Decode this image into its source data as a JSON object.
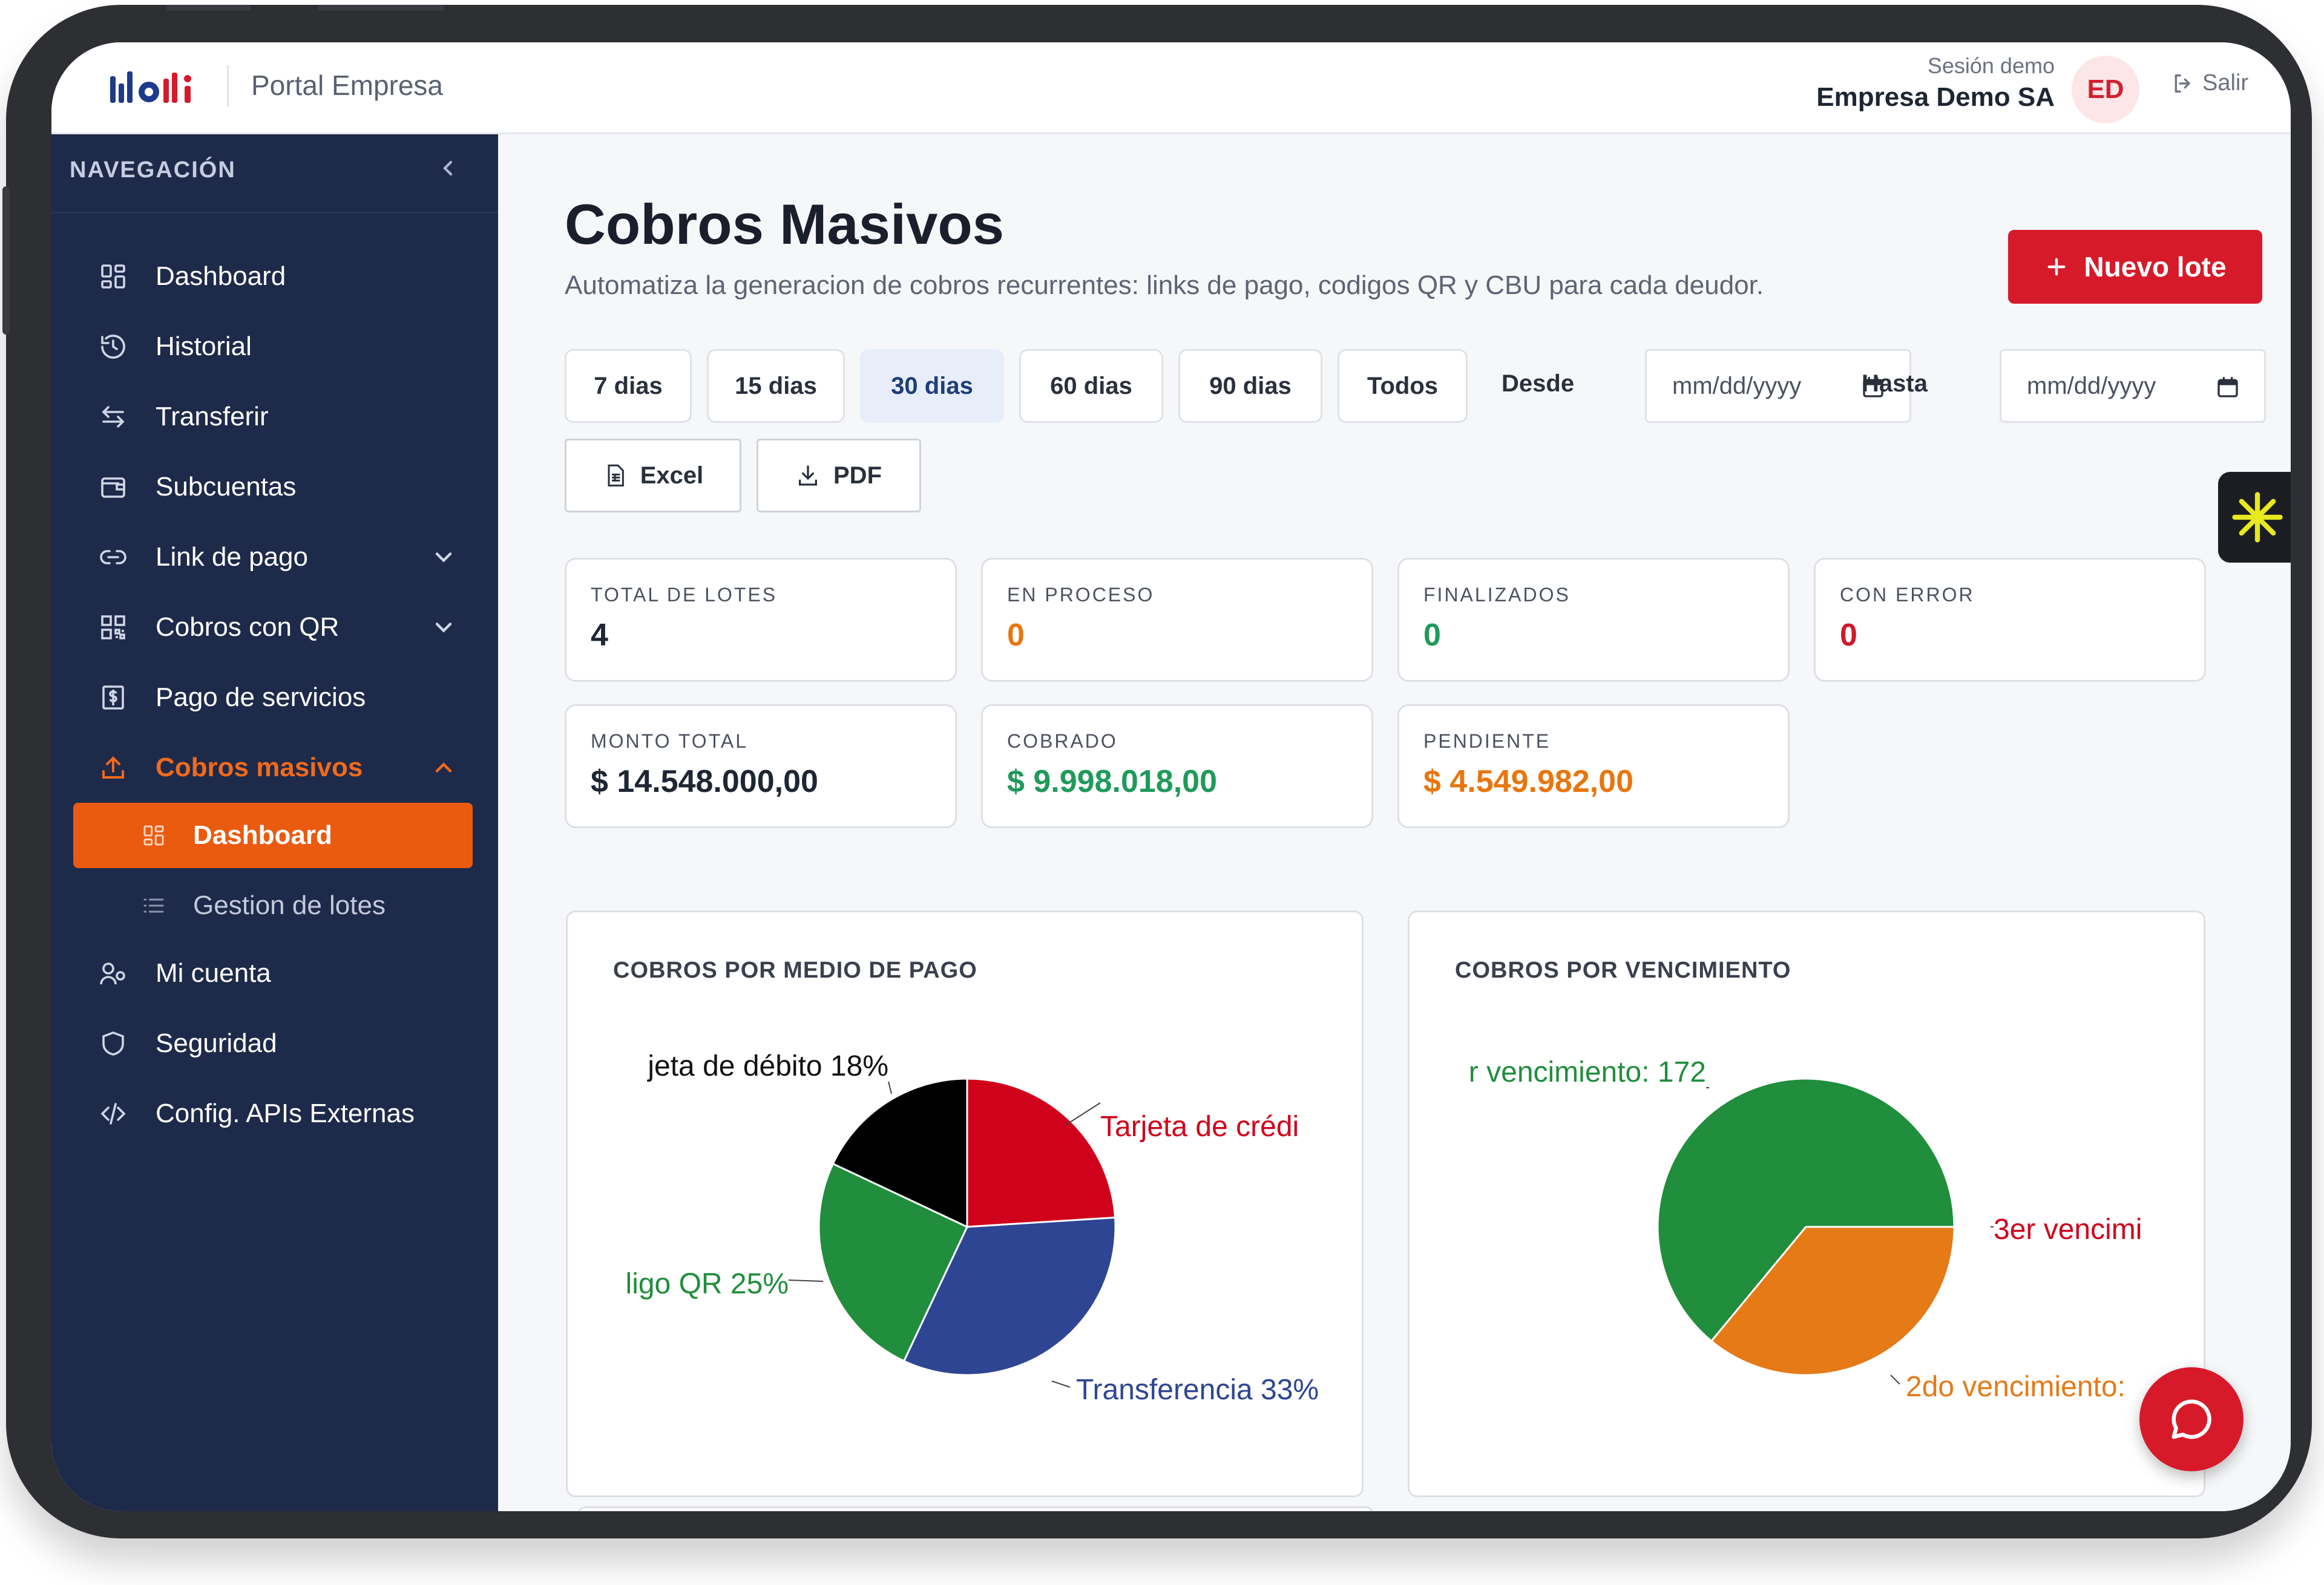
{
  "header": {
    "portal_name": "Portal Empresa",
    "session_label": "Sesión demo",
    "company": "Empresa Demo SA",
    "avatar_initials": "ED",
    "logout_label": "Salir"
  },
  "sidebar": {
    "heading": "NAVEGACIÓN",
    "items": [
      {
        "label": "Dashboard",
        "icon": "grid-icon"
      },
      {
        "label": "Historial",
        "icon": "history-icon"
      },
      {
        "label": "Transferir",
        "icon": "transfer-icon"
      },
      {
        "label": "Subcuentas",
        "icon": "wallet-icon"
      },
      {
        "label": "Link de pago",
        "icon": "link-icon"
      },
      {
        "label": "Cobros con QR",
        "icon": "qr-icon"
      },
      {
        "label": "Pago de servicios",
        "icon": "dollar-icon"
      },
      {
        "label": "Cobros masivos",
        "icon": "upload-icon"
      },
      {
        "label": "Mi cuenta",
        "icon": "users-icon"
      },
      {
        "label": "Seguridad",
        "icon": "shield-icon"
      },
      {
        "label": "Config. APIs Externas",
        "icon": "code-icon"
      }
    ],
    "sub_items": [
      {
        "label": "Dashboard",
        "icon": "grid-icon"
      },
      {
        "label": "Gestion de lotes",
        "icon": "list-icon"
      }
    ]
  },
  "page": {
    "title": "Cobros Masivos",
    "subtitle": "Automatiza la generacion de cobros recurrentes: links de pago, codigos QR y CBU para cada deudor.",
    "new_button": "Nuevo lote"
  },
  "filters": {
    "ranges": [
      "7 dias",
      "15 dias",
      "30 dias",
      "60 dias",
      "90 dias",
      "Todos"
    ],
    "selected": "30 dias",
    "from_label": "Desde",
    "to_label": "Hasta",
    "date_placeholder": "mm/dd/yyyy",
    "export_excel": "Excel",
    "export_pdf": "PDF"
  },
  "stats": [
    {
      "label": "TOTAL DE LOTES",
      "value": "4",
      "color": "#1f2633"
    },
    {
      "label": "EN PROCESO",
      "value": "0",
      "color": "#e8760f"
    },
    {
      "label": "FINALIZADOS",
      "value": "0",
      "color": "#1f9a5a"
    },
    {
      "label": "CON ERROR",
      "value": "0",
      "color": "#d0182a"
    },
    {
      "label": "MONTO TOTAL",
      "value": "$ 14.548.000,00",
      "color": "#1f2633"
    },
    {
      "label": "COBRADO",
      "value": "$ 9.998.018,00",
      "color": "#1f9a5a"
    },
    {
      "label": "PENDIENTE",
      "value": "$ 4.549.982,00",
      "color": "#e8760f"
    }
  ],
  "chart_data": [
    {
      "type": "pie",
      "title": "COBROS POR MEDIO DE PAGO",
      "slices": [
        {
          "label": "Tarjeta de crédi",
          "value": 24,
          "color": "#d0021b"
        },
        {
          "label": "Transferencia 33%",
          "value": 33,
          "color": "#2e4593"
        },
        {
          "label": "ligo QR 25%",
          "value": 25,
          "color": "#208e3c"
        },
        {
          "label": "jeta de débito 18%",
          "value": 18,
          "color": "#000000"
        }
      ]
    },
    {
      "type": "pie",
      "title": "COBROS POR VENCIMIENTO",
      "slices": [
        {
          "label": "r vencimiento: 172",
          "value": 64,
          "color": "#208e3c"
        },
        {
          "label": "3er vencimi",
          "value": 0,
          "color": "#d0021b"
        },
        {
          "label": "2do vencimiento:",
          "value": 36,
          "color": "#e57a17"
        }
      ]
    }
  ]
}
